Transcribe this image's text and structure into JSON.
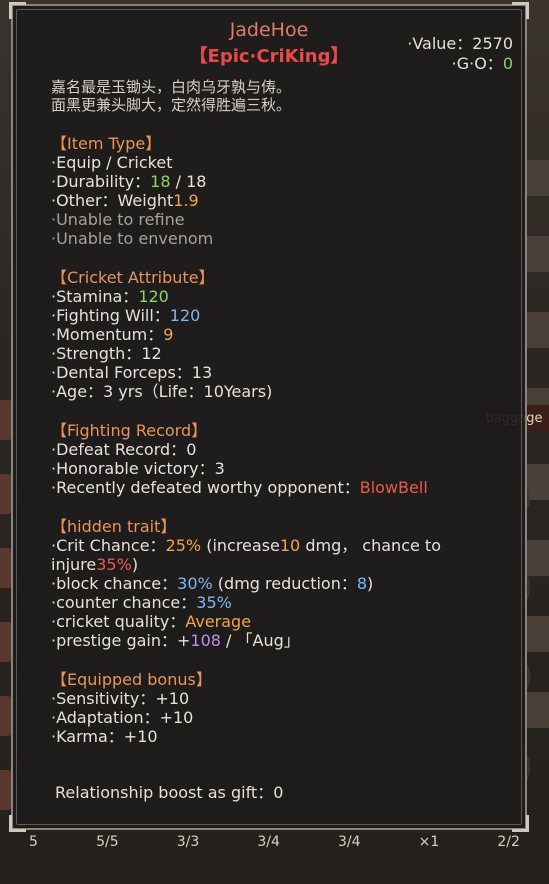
{
  "item": {
    "name": "JadeHoe",
    "rarity": "【Epic·CriKing】",
    "value_label": "·Value：",
    "value": "2570",
    "go_label": "·G·O：",
    "go": "0",
    "description_line1": "嘉名最是玉锄头，白肉乌牙孰与俦。",
    "description_line2": "面黑更兼头脚大，定然得胜遍三秋。"
  },
  "item_type": {
    "header": "【Item Type】",
    "equip": "·Equip /  Cricket",
    "durability_label": "·Durability：",
    "durability_current": "18",
    "durability_sep": " / ",
    "durability_max": "18",
    "other_label": "·Other：Weight",
    "weight": "1.9",
    "refine": "·Unable to refine",
    "envenom": "·Unable to envenom"
  },
  "cricket_attribute": {
    "header": "【Cricket Attribute】",
    "stamina_label": "·Stamina：",
    "stamina": "120",
    "will_label": "·Fighting Will：",
    "will": "120",
    "momentum_label": "·Momentum：",
    "momentum": "9",
    "strength_label": "·Strength：",
    "strength": "12",
    "forceps_label": "·Dental Forceps：",
    "forceps": "13",
    "age": "·Age：3 yrs（Life：10Years)"
  },
  "fighting_record": {
    "header": "【Fighting Record】",
    "defeat_label": "·Defeat Record：",
    "defeat": "0",
    "honorable_label": "·Honorable victory：",
    "honorable": "3",
    "recent_label": "·Recently defeated worthy opponent：",
    "recent": "BlowBell"
  },
  "hidden_trait": {
    "header": "【hidden trait】",
    "crit_label": "·Crit Chance：",
    "crit": "25%",
    "crit_mid1": " (increase",
    "crit_dmg": "10",
    "crit_mid2": " dmg，  chance to injure",
    "crit_injure": "35%",
    "crit_end": ")",
    "block_label": "·block chance：",
    "block": "30%",
    "block_mid": " (dmg reduction：",
    "block_red": "8",
    "block_end": ")",
    "counter_label": "·counter chance：",
    "counter": "35%",
    "quality_label": "·cricket quality：",
    "quality": "Average",
    "prestige_label": "·prestige gain：+",
    "prestige": "108",
    "prestige_end": " / 「Aug」"
  },
  "equipped_bonus": {
    "header": "【Equipped bonus】",
    "sensitivity": "·Sensitivity：+10",
    "adaptation": "·Adaptation：+10",
    "karma": "·Karma：+10"
  },
  "gift": {
    "label": "Relationship boost as gift：",
    "value": "0"
  },
  "background": {
    "baggage": "baggage",
    "counts": [
      "5",
      "5/5",
      "3/3",
      "3/4",
      "3/4",
      "×1",
      "2/2"
    ]
  }
}
